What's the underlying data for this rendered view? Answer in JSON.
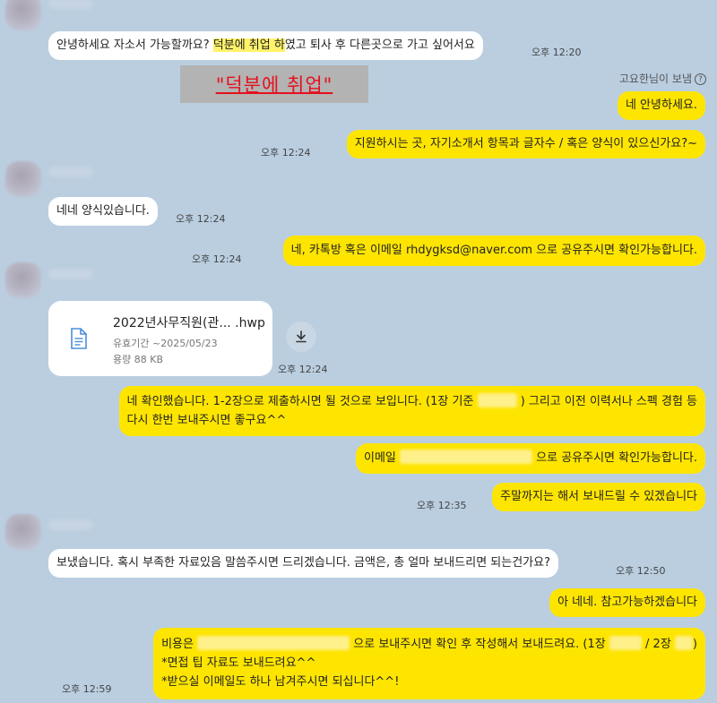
{
  "messages": {
    "m1": {
      "part1": "안녕하세요 자소서 가능할까요? ",
      "highlight": "덕분에 취업 하",
      "part2": "였고 퇴사 후 다른곳으로 가고 싶어서요",
      "time": "오후 12:20"
    },
    "caption": "\"덕분에 취업\"",
    "read_receipt": "고요한님이 보냄",
    "m2": {
      "text": "네 안녕하세요.",
      "time": ""
    },
    "m3": {
      "text": "지원하시는 곳, 자기소개서 항목과 글자수 / 혹은 양식이 있으신가요?~",
      "time": "오후 12:24"
    },
    "m4": {
      "text": "네네 양식있습니다.",
      "time": "오후 12:24"
    },
    "m5": {
      "text": "네, 카톡방 혹은 이메일 rhdygksd@naver.com 으로 공유주시면 확인가능합니다.",
      "time": "오후 12:24"
    },
    "file": {
      "name": "2022년사무직원(관... .hwp",
      "expiry": "유효기간 ~2025/05/23",
      "size": "용량 88 KB",
      "time": "오후 12:24"
    },
    "m6": {
      "line1a": "네 확인했습니다. 1-2장으로 제출하시면 될 것으로 보입니다. (1장 기준",
      "line1b": ") 그리고 이전 이력서나 스펙 경험 등",
      "line2": "다시 한번 보내주시면 좋구요^^"
    },
    "m7": {
      "a": "이메일",
      "b": "으로 공유주시면 확인가능합니다."
    },
    "m8": {
      "text": "주말까지는 해서 보내드릴 수 있겠습니다",
      "time": "오후 12:35"
    },
    "m9": {
      "text": "보냈습니다. 혹시 부족한 자료있음 말씀주시면 드리겠습니다. 금액은, 총 얼마 보내드리면 되는건가요?",
      "time": "오후 12:50"
    },
    "m10": {
      "text": "아 네네. 참고가능하겠습니다"
    },
    "m11": {
      "l1a": "비용은",
      "l1b": "으로 보내주시면 확인 후 작성해서 보내드려요. (1장",
      "l1c": "/ 2장",
      "l1d": ")",
      "l2": "*면접 팁 자료도 보내드려요^^",
      "l3": "*받으실 이메일도 하나 남겨주시면 되십니다^^!",
      "time": "오후 12:59"
    }
  },
  "icons": {
    "file": "document-icon",
    "download": "download-icon",
    "info": "question-circle-icon"
  }
}
